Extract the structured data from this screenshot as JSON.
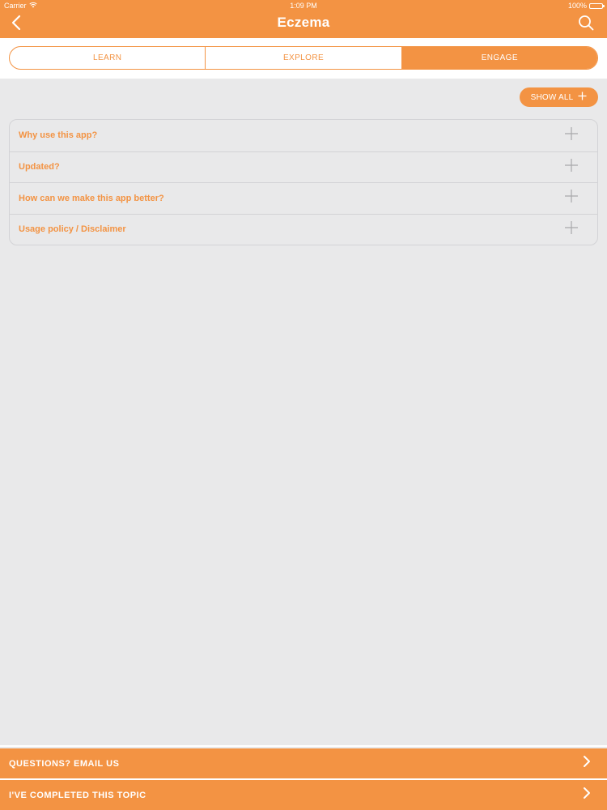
{
  "status_bar": {
    "carrier": "Carrier",
    "time": "1:09 PM",
    "battery": "100%",
    "battery_level": 1.0
  },
  "nav": {
    "title": "Eczema",
    "back_icon": "chevron-left-icon",
    "search_icon": "search-icon"
  },
  "tabs": [
    {
      "label": "LEARN",
      "active": false
    },
    {
      "label": "EXPLORE",
      "active": false
    },
    {
      "label": "ENGAGE",
      "active": true
    }
  ],
  "show_all_label": "SHOW ALL",
  "accordion": [
    {
      "title": "Why use this app?"
    },
    {
      "title": "Updated?"
    },
    {
      "title": "How can we make this app better?"
    },
    {
      "title": "Usage policy / Disclaimer"
    }
  ],
  "footer": {
    "email_label": "QUESTIONS? EMAIL US",
    "completed_label": "I'VE COMPLETED THIS TOPIC"
  },
  "colors": {
    "accent": "#f39343",
    "background": "#e9e9ea",
    "divider": "#d3d3d6"
  }
}
